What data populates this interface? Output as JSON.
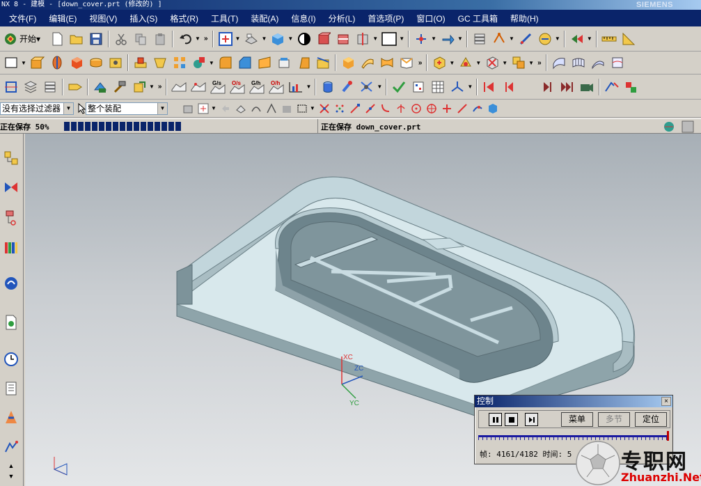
{
  "window": {
    "title": "NX 8 - 建模 - [down_cover.prt (修改的) ]",
    "brand": "SIEMENS"
  },
  "menubar": {
    "items": [
      "文件(F)",
      "编辑(E)",
      "视图(V)",
      "插入(S)",
      "格式(R)",
      "工具(T)",
      "装配(A)",
      "信息(I)",
      "分析(L)",
      "首选项(P)",
      "窗口(O)",
      "GC 工具箱",
      "帮助(H)"
    ]
  },
  "toolbar": {
    "start_label": "开始▾"
  },
  "selection_bar": {
    "filter_value": "没有选择过滤器",
    "scope_value": "整个装配"
  },
  "status_bar": {
    "left_text": "正在保存 50%",
    "progress_percent": 50,
    "right_text": "正在保存 down_cover.prt"
  },
  "viewport": {
    "axis_labels": {
      "x": "XC",
      "y": "YC",
      "z": "ZC"
    },
    "model_color": "#c9dde3",
    "model_wall_color": "#6f878e"
  },
  "control_dialog": {
    "title": "控制",
    "close_label": "×",
    "menu_label": "菜单",
    "step_label": "多节",
    "position_label": "定位",
    "frame_label": "帧:",
    "frame_value": "4161/4182",
    "time_label": "时间:",
    "time_value": "5"
  },
  "watermark": {
    "cn_text": "专职网",
    "en_text": "Zhuanzhi.Net"
  },
  "colors": {
    "title_blue": "#0a246a",
    "chrome": "#d4d0c8",
    "progress": "#0a246a"
  }
}
